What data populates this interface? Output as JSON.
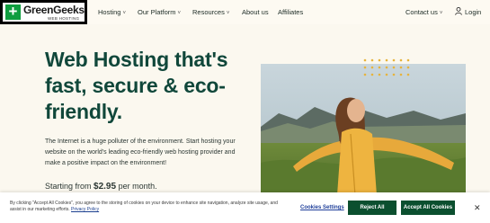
{
  "brand": {
    "name": "GreenGeeks",
    "tagline": "WEB HOSTING",
    "mark": "+"
  },
  "nav": {
    "items": [
      {
        "label": "Hosting",
        "dropdown": true
      },
      {
        "label": "Our Platform",
        "dropdown": true
      },
      {
        "label": "Resources",
        "dropdown": true
      },
      {
        "label": "About us",
        "dropdown": false
      },
      {
        "label": "Affiliates",
        "dropdown": false
      }
    ],
    "contact": "Contact us",
    "login": "Login",
    "caret": "˅"
  },
  "hero": {
    "title": "Web Hosting that's fast, secure & eco-friendly.",
    "body": "The Internet is a huge polluter of the environment. Start hosting your website on the world's leading eco-friendly web hosting provider and make a positive impact on the environment!",
    "price_prefix": "Starting from ",
    "price_value": "$2.95",
    "price_suffix": " per month."
  },
  "cookie": {
    "text": "By clicking \"Accept All Cookies\", you agree to the storing of cookies on your device to enhance site navigation, analyze site usage, and assist in our marketing efforts. ",
    "policy_link": "Privacy Policy",
    "settings": "Cookies Settings",
    "reject": "Reject All",
    "accept": "Accept All Cookies",
    "close": "✕"
  },
  "colors": {
    "accent_green": "#10473a",
    "button_green": "#0b4f2f",
    "logo_green": "#0f9d3f",
    "dot_gold": "#e7b33c",
    "background": "#fbf8ef"
  }
}
